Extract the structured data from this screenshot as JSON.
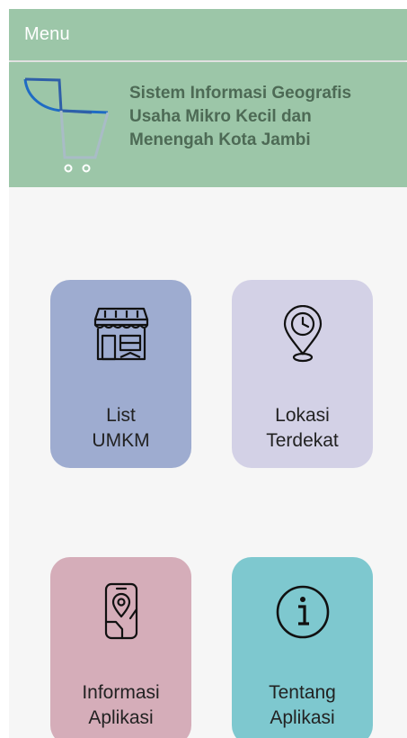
{
  "appbar": {
    "title": "Menu"
  },
  "header": {
    "logo_icon": "shopping-cart-icon",
    "line1": "Sistem Informasi Geografis",
    "line2": "Usaha Mikro Kecil dan",
    "line3": "Menengah Kota Jambi"
  },
  "tiles": [
    {
      "line1": "List",
      "line2": "UMKM",
      "icon": "storefront-icon",
      "color": "#9eacd0"
    },
    {
      "line1": "Lokasi",
      "line2": "Terdekat",
      "icon": "location-clock-icon",
      "color": "#d3d1e6"
    },
    {
      "line1": "Informasi",
      "line2": "Aplikasi",
      "icon": "phone-location-icon",
      "color": "#d5adb9"
    },
    {
      "line1": "Tentang",
      "line2": "Aplikasi",
      "icon": "info-icon",
      "color": "#7ec8cf"
    }
  ]
}
